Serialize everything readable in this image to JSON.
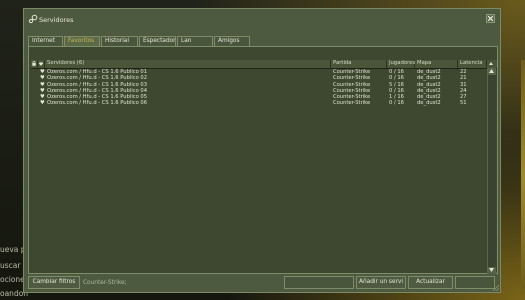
{
  "background": {
    "lines": [
      "ueva p",
      "uscar",
      "ocione",
      "oandon"
    ]
  },
  "window": {
    "title": "Servidores",
    "tabs": [
      {
        "label": "Internet",
        "active": false
      },
      {
        "label": "Favoritos",
        "active": true
      },
      {
        "label": "Historial",
        "active": false
      },
      {
        "label": "Espectador",
        "active": false
      },
      {
        "label": "Lan",
        "active": false
      },
      {
        "label": "Amigos",
        "active": false
      }
    ],
    "table": {
      "headers": {
        "lock": "",
        "fav": "",
        "name": "Servidores (6)",
        "game": "Partida",
        "players": "Jugadores",
        "map": "Mapa",
        "latency": "Latencia"
      },
      "rows": [
        {
          "name": "Ozeros.com / Hfu.d - CS 1.6 Publico 01",
          "game": "Counter-Strike",
          "players": "0 / 16",
          "map": "de_dust2",
          "latency": "22"
        },
        {
          "name": "Ozeros.com / Hfu.d - CS 1.6 Publico 02",
          "game": "Counter-Strike",
          "players": "0 / 16",
          "map": "de_dust2",
          "latency": "21"
        },
        {
          "name": "Ozeros.com / Hfu.d - CS 1.6 Publico 03",
          "game": "Counter-Strike",
          "players": "5 / 16",
          "map": "de_dust2",
          "latency": "31"
        },
        {
          "name": "Ozeros.com / Hfu.d - CS 1.6 Publico 04",
          "game": "Counter-Strike",
          "players": "0 / 16",
          "map": "de_dust2",
          "latency": "24"
        },
        {
          "name": "Ozeros.com / Hfu.d - CS 1.6 Publico 05",
          "game": "Counter-Strike",
          "players": "1 / 16",
          "map": "de_dust2",
          "latency": "27"
        },
        {
          "name": "Ozeros.com / Hfu.d - CS 1.6 Publico 06",
          "game": "Counter-Strike",
          "players": "0 / 16",
          "map": "de_dust2",
          "latency": "51"
        }
      ]
    },
    "footer": {
      "change_filters": "Cambiar filtros",
      "filter_value": "Counter-Strike;",
      "btn_disabled_1": "",
      "add_server": "Añadir un servi",
      "refresh": "Actualizar",
      "btn_disabled_2": ""
    }
  }
}
